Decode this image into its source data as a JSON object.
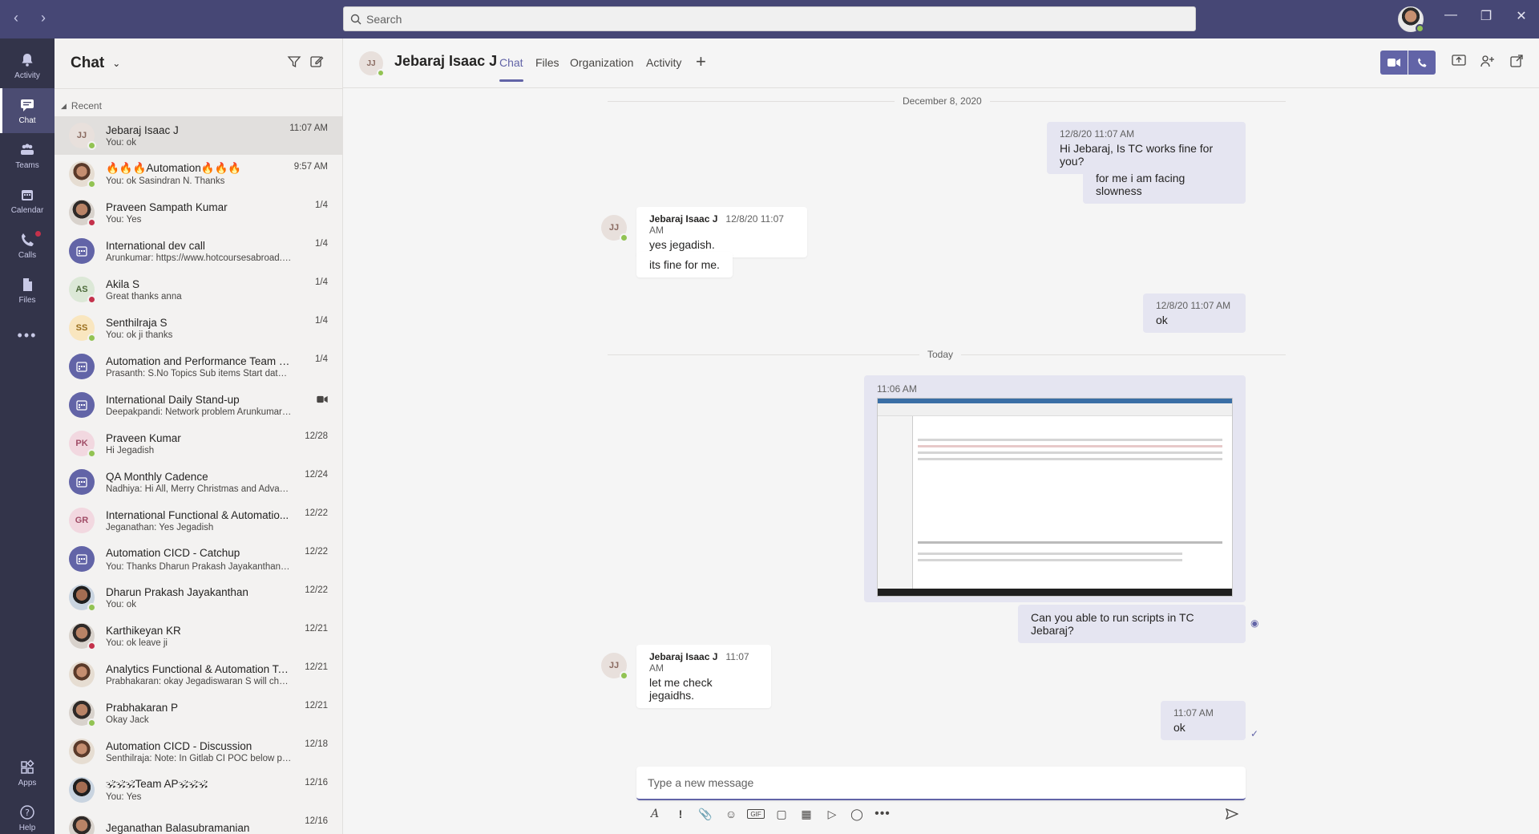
{
  "search": {
    "placeholder": "Search"
  },
  "rail": [
    {
      "label": "Activity",
      "icon": "bell-icon"
    },
    {
      "label": "Chat",
      "icon": "chat-icon"
    },
    {
      "label": "Teams",
      "icon": "teams-icon"
    },
    {
      "label": "Calendar",
      "icon": "calendar-icon"
    },
    {
      "label": "Calls",
      "icon": "phone-icon"
    },
    {
      "label": "Files",
      "icon": "file-icon"
    },
    {
      "label": "Apps",
      "icon": "apps-icon"
    },
    {
      "label": "Help",
      "icon": "help-icon"
    }
  ],
  "list": {
    "title": "Chat",
    "section": "Recent",
    "chats": [
      {
        "name": "Jebaraj Isaac J",
        "preview": "You: ok",
        "time": "11:07 AM",
        "initials": "JJ"
      },
      {
        "name": "🔥🔥🔥Automation🔥🔥🔥",
        "preview": "You: ok Sasindran N. Thanks",
        "time": "9:57 AM",
        "initials": ""
      },
      {
        "name": "Praveen Sampath Kumar",
        "preview": "You: Yes",
        "time": "1/4",
        "initials": ""
      },
      {
        "name": "International dev call",
        "preview": "Arunkumar: https://www.hotcoursesabroad.com/s...",
        "time": "1/4",
        "initials": ""
      },
      {
        "name": "Akila S",
        "preview": "Great thanks anna",
        "time": "1/4",
        "initials": "AS"
      },
      {
        "name": "Senthilraja S",
        "preview": "You: ok ji thanks",
        "time": "1/4",
        "initials": "SS"
      },
      {
        "name": "Automation and Performance Team Catc...",
        "preview": "Prasanth: S.No Topics Sub items Start date End Da...",
        "time": "1/4",
        "initials": ""
      },
      {
        "name": "International Daily Stand-up",
        "preview": "Deepakpandi: Network problem Arunkumar M",
        "time": "",
        "initials": ""
      },
      {
        "name": "Praveen Kumar",
        "preview": "Hi Jegadish",
        "time": "12/28",
        "initials": "PK"
      },
      {
        "name": "QA Monthly Cadence",
        "preview": "Nadhiya: Hi All, Merry Christmas and Advance H...",
        "time": "12/24",
        "initials": ""
      },
      {
        "name": "International Functional & Automatio...",
        "preview": "Jeganathan: Yes Jegadish",
        "time": "12/22",
        "initials": "GR"
      },
      {
        "name": "Automation CICD - Catchup",
        "preview": "You: Thanks Dharun Prakash Jayakanthan 🙂",
        "time": "12/22",
        "initials": ""
      },
      {
        "name": "Dharun Prakash Jayakanthan",
        "preview": "You: ok",
        "time": "12/22",
        "initials": ""
      },
      {
        "name": "Karthikeyan KR",
        "preview": "You: ok leave ji",
        "time": "12/21",
        "initials": ""
      },
      {
        "name": "Analytics Functional & Automation Te...",
        "preview": "Prabhakaran: okay Jegadiswaran S will check the...",
        "time": "12/21",
        "initials": ""
      },
      {
        "name": "Prabhakaran P",
        "preview": "Okay Jack",
        "time": "12/21",
        "initials": ""
      },
      {
        "name": "Automation CICD - Discussion",
        "preview": "Senthilraja: Note: In Gitlab CI POC below process...",
        "time": "12/18",
        "initials": ""
      },
      {
        "name": "🕉🕉🕉Team AP🕉🕉🕉",
        "preview": "You: Yes",
        "time": "12/16",
        "initials": ""
      },
      {
        "name": "Jeganathan Balasubramanian",
        "preview": "",
        "time": "12/16",
        "initials": ""
      }
    ]
  },
  "conversation": {
    "name": "Jebaraj Isaac J",
    "initials": "JJ",
    "tabs": [
      "Chat",
      "Files",
      "Organization",
      "Activity"
    ],
    "date1": "December 8, 2020",
    "date2": "Today",
    "messages": [
      {
        "meta": "12/8/20 11:07 AM",
        "text": "Hi Jebaraj, Is TC works fine for you?"
      },
      {
        "meta": "",
        "text": "for me i am facing slowness"
      },
      {
        "author": "Jebaraj Isaac J",
        "meta": "12/8/20 11:07 AM",
        "text": "yes jegadish."
      },
      {
        "meta": "",
        "text": "its fine for me."
      },
      {
        "meta": "12/8/20 11:07 AM",
        "text": "ok"
      },
      {
        "meta": "11:06 AM",
        "text": ""
      },
      {
        "meta": "",
        "text": "Can you able to run scripts in TC Jebaraj?"
      },
      {
        "author": "Jebaraj Isaac J",
        "meta": "11:07 AM",
        "text": "let me check jegaidhs."
      },
      {
        "meta": "11:07 AM",
        "text": "ok"
      }
    ]
  },
  "compose": {
    "placeholder": "Type a new message"
  },
  "colors": {
    "accent": "#6264a7",
    "titlebar": "#464775",
    "rail": "#33344a"
  }
}
